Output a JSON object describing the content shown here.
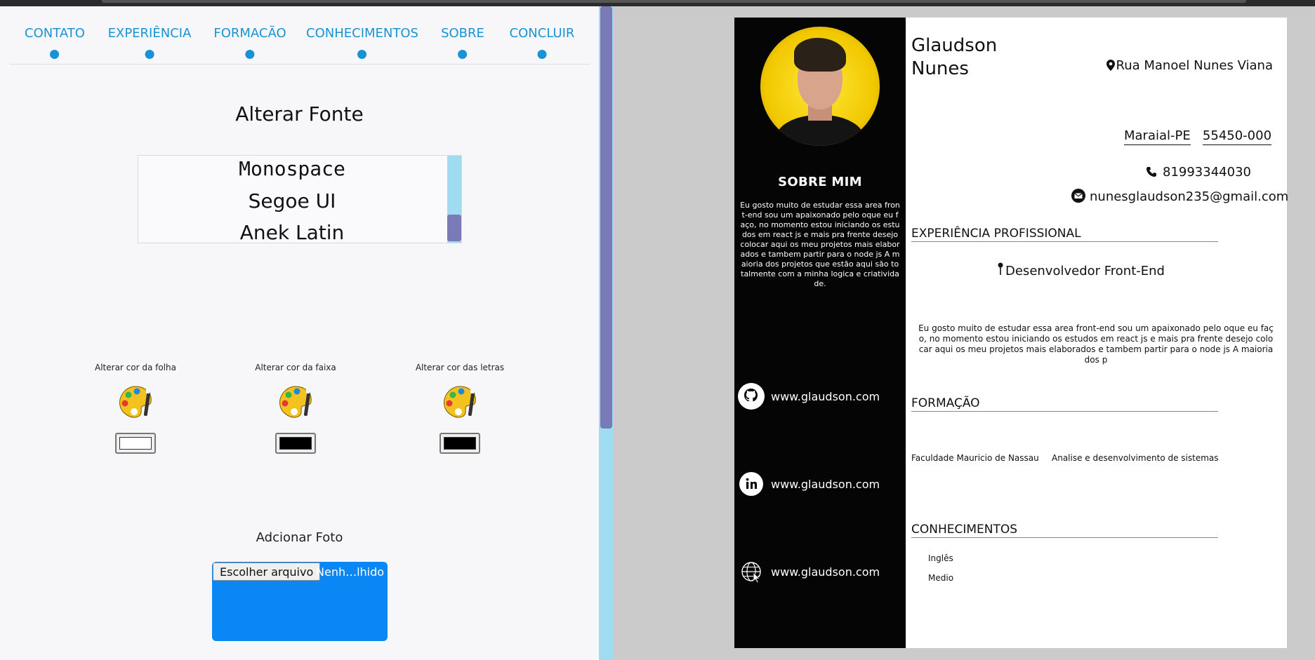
{
  "steps": [
    {
      "label": "CONTATO"
    },
    {
      "label": "EXPERIÊNCIA"
    },
    {
      "label": "FORMACÃO"
    },
    {
      "label": "CONHECIMENTOS"
    },
    {
      "label": "SOBRE"
    },
    {
      "label": "CONCLUIR"
    }
  ],
  "editor": {
    "font_title": "Alterar Fonte",
    "font_options": [
      "Monospace",
      "Segoe UI",
      "Anek Latin"
    ],
    "colors": [
      {
        "label": "Alterar cor da folha",
        "value": "#ffffff"
      },
      {
        "label": "Alterar cor da faixa",
        "value": "#000000"
      },
      {
        "label": "Alterar cor das letras",
        "value": "#000000"
      }
    ],
    "photo_title": "Adcionar Foto",
    "choose_file_label": "Escolher arquivo",
    "no_file_label": "Nenh…lhido"
  },
  "resume": {
    "name_line1": "Glaudson",
    "name_line2": "Nunes",
    "address": "Rua Manoel Nunes Viana",
    "city": "Maraial-PE",
    "zip": "55450-000",
    "phone": "81993344030",
    "email": "nunesglaudson235@gmail.com",
    "about_title": "SOBRE MIM",
    "about_text": "Eu gosto muito de estudar essa area front-end sou um apaixonado pelo oque eu faço, no momento estou iniciando os estudos em react js e mais pra frente desejo colocar aqui os meu projetos mais elaborados e tambem partir para o node js A maioria dos projetos que estão aqui são totalmente com a minha logica e criatividade.",
    "links": [
      {
        "icon": "github-icon",
        "url": "www.glaudson.com"
      },
      {
        "icon": "linkedin-icon",
        "url": "www.glaudson.com"
      },
      {
        "icon": "globe-icon",
        "url": "www.glaudson.com"
      }
    ],
    "experience_title": "EXPERIÊNCIA PROFISSIONAL",
    "role": "Desenvolvedor Front-End",
    "experience_text": "Eu gosto muito de estudar essa area front-end sou um apaixonado pelo oque eu faço, no momento estou iniciando os estudos em react js e mais pra frente desejo colocar aqui os meu projetos mais elaborados e tambem partir para o node js A maioria dos p",
    "education_title": "FORMAÇÃO",
    "institution": "Faculdade Mauricio de Nassau",
    "course": "Analise e desenvolvimento de sistemas",
    "skills_title": "CONHECIMENTOS",
    "skill_name": "Inglês",
    "skill_level": "Medio"
  },
  "colors": {
    "accent": "#1a93d4",
    "scrollbar_track": "#9fdcf1",
    "scrollbar_thumb": "#7a7ab6",
    "upload_bg": "#0a86f5",
    "sidebar_bg": "#050505",
    "photo_bg": "#f1c800"
  }
}
